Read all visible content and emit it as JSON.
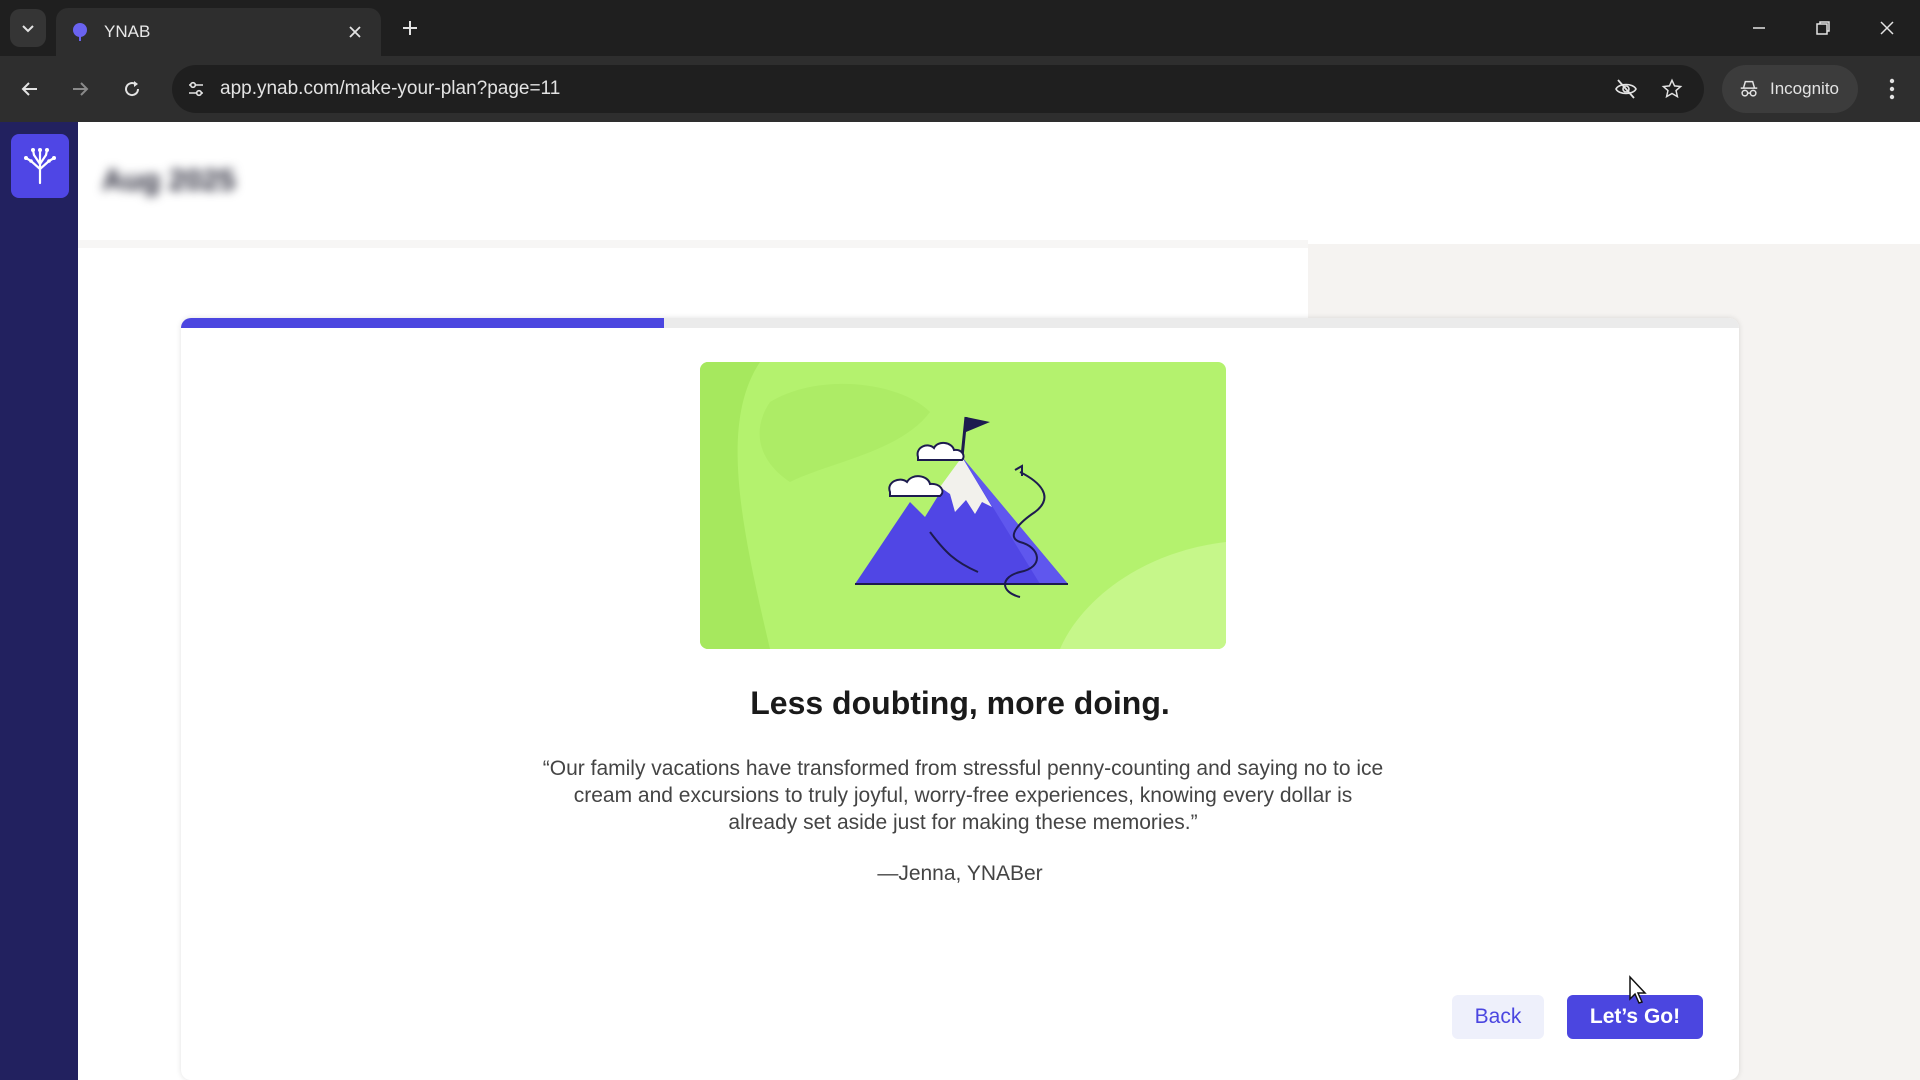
{
  "browser": {
    "tab_title": "YNAB",
    "url": "app.ynab.com/make-your-plan?page=11",
    "incognito_label": "Incognito"
  },
  "app": {
    "month_label": "Aug 2025"
  },
  "onboarding": {
    "progress_fraction": 0.31,
    "headline": "Less doubting, more doing.",
    "quote": "“Our family vacations have transformed from stressful penny-counting and saying no to ice cream and excursions to truly joyful, worry-free experiences, knowing every dollar is already set aside just for making these memories.”",
    "attribution": "—Jenna, YNABer",
    "back_label": "Back",
    "go_label": "Let’s Go!"
  },
  "colors": {
    "accent": "#4b46e0",
    "sidebar": "#22215f",
    "illustration_bg": "#b4f26e"
  },
  "icons": [
    "chevron-down-icon",
    "ynab-tree-icon",
    "close-icon",
    "plus-icon",
    "minimize-icon",
    "restore-icon",
    "back-arrow-icon",
    "forward-arrow-icon",
    "reload-icon",
    "site-settings-icon",
    "eye-off-icon",
    "star-icon",
    "incognito-icon",
    "more-vert-icon"
  ]
}
